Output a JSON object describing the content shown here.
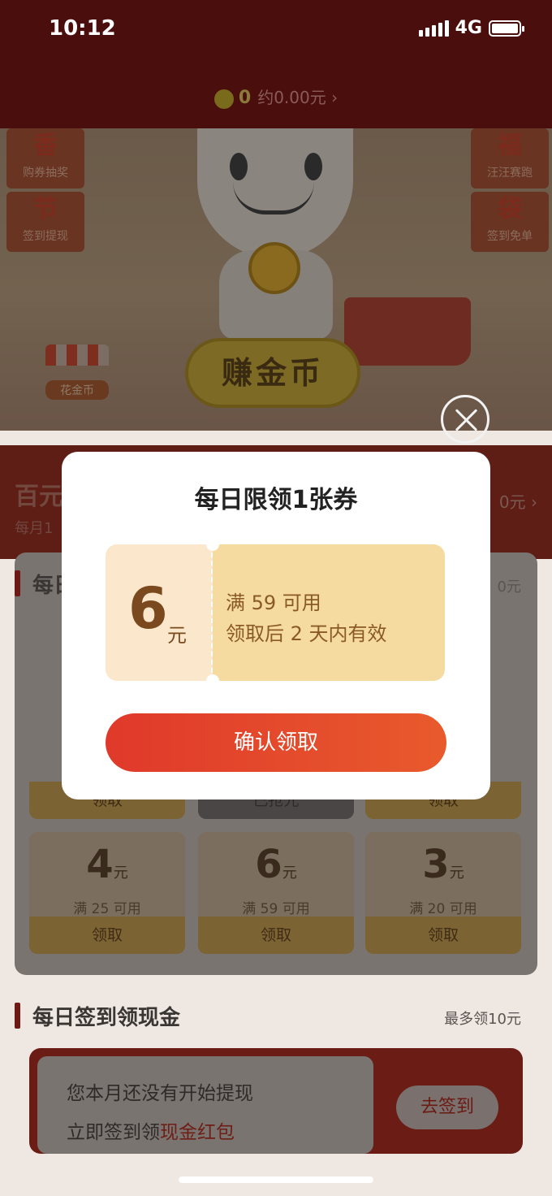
{
  "status": {
    "time": "10:12",
    "network": "4G"
  },
  "header": {
    "coin_count": "0",
    "coin_value": "约0.00元 ›"
  },
  "hero": {
    "tiles_left": [
      {
        "big": "香",
        "small": "购券抽奖"
      },
      {
        "big": "节",
        "small": "签到提现"
      }
    ],
    "tiles_right": [
      {
        "big": "福",
        "small": "汪汪赛跑"
      },
      {
        "big": "袋",
        "small": "签到免单"
      }
    ],
    "earn_button": "赚金币",
    "shop_label": "花金币"
  },
  "band": {
    "title": "百元",
    "subtitle": "每月1",
    "right": "0元 ›"
  },
  "coupon_section": {
    "title": "每日",
    "right": "0元",
    "row1_actions": [
      "领取",
      "已抢光",
      "领取"
    ],
    "coupons": [
      {
        "amount": "4",
        "unit": "元",
        "condition": "满 25 可用",
        "action": "领取"
      },
      {
        "amount": "6",
        "unit": "元",
        "condition": "满 59 可用",
        "action": "领取"
      },
      {
        "amount": "3",
        "unit": "元",
        "condition": "满 20 可用",
        "action": "领取"
      }
    ]
  },
  "signin": {
    "title": "每日签到领现金",
    "right": "最多领10元",
    "line1": "您本月还没有开始提现",
    "line2_prefix": "立即签到领",
    "line2_highlight": "现金红包",
    "button": "去签到"
  },
  "modal": {
    "title": "每日限领1张券",
    "amount": "6",
    "unit": "元",
    "condition": "满 59 可用",
    "validity": "领取后 2 天内有效",
    "confirm": "确认领取"
  },
  "colors": {
    "confirm_start": "#e0392b",
    "confirm_end": "#e85a2c",
    "ticket_left": "#fbe8cc",
    "ticket_right": "#f5dba0"
  }
}
